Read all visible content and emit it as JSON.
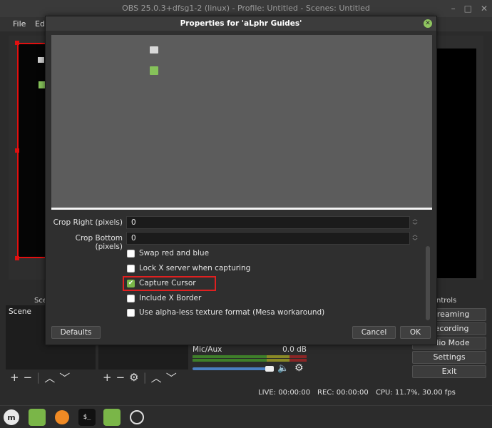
{
  "window": {
    "title": "OBS 25.0.3+dfsg1-2 (linux) - Profile: Untitled - Scenes: Untitled",
    "menu": [
      "File",
      "Edi"
    ]
  },
  "docks": {
    "scenes_header": "Sce",
    "scenes_items": [
      "Scene"
    ],
    "controls_header": "ntrols",
    "controls_buttons": [
      "Streaming",
      "Recording",
      "udio Mode",
      "Settings",
      "Exit"
    ]
  },
  "mixer": {
    "channel_name": "Mic/Aux",
    "level": "0.0 dB",
    "volume_fraction": 0.92
  },
  "status": {
    "live": "LIVE: 00:00:00",
    "rec": "REC: 00:00:00",
    "cpu": "CPU: 11.7%, 30.00 fps"
  },
  "dialog": {
    "title": "Properties for 'aLphr Guides'",
    "fields": [
      {
        "label": "Crop Right (pixels)",
        "value": "0"
      },
      {
        "label": "Crop Bottom (pixels)",
        "value": "0"
      }
    ],
    "checkboxes": [
      {
        "label": "Swap red and blue",
        "checked": false
      },
      {
        "label": "Lock X server when capturing",
        "checked": false
      },
      {
        "label": "Capture Cursor",
        "checked": true
      },
      {
        "label": "Include X Border",
        "checked": false
      },
      {
        "label": "Use alpha-less texture format (Mesa workaround)",
        "checked": false
      }
    ],
    "buttons": {
      "defaults": "Defaults",
      "cancel": "Cancel",
      "ok": "OK"
    }
  },
  "taskbar": {
    "terminal_glyph": "$_"
  },
  "colors": {
    "accent_green": "#7ab648",
    "highlight_red": "#e02020",
    "preview_red": "#e01010"
  }
}
